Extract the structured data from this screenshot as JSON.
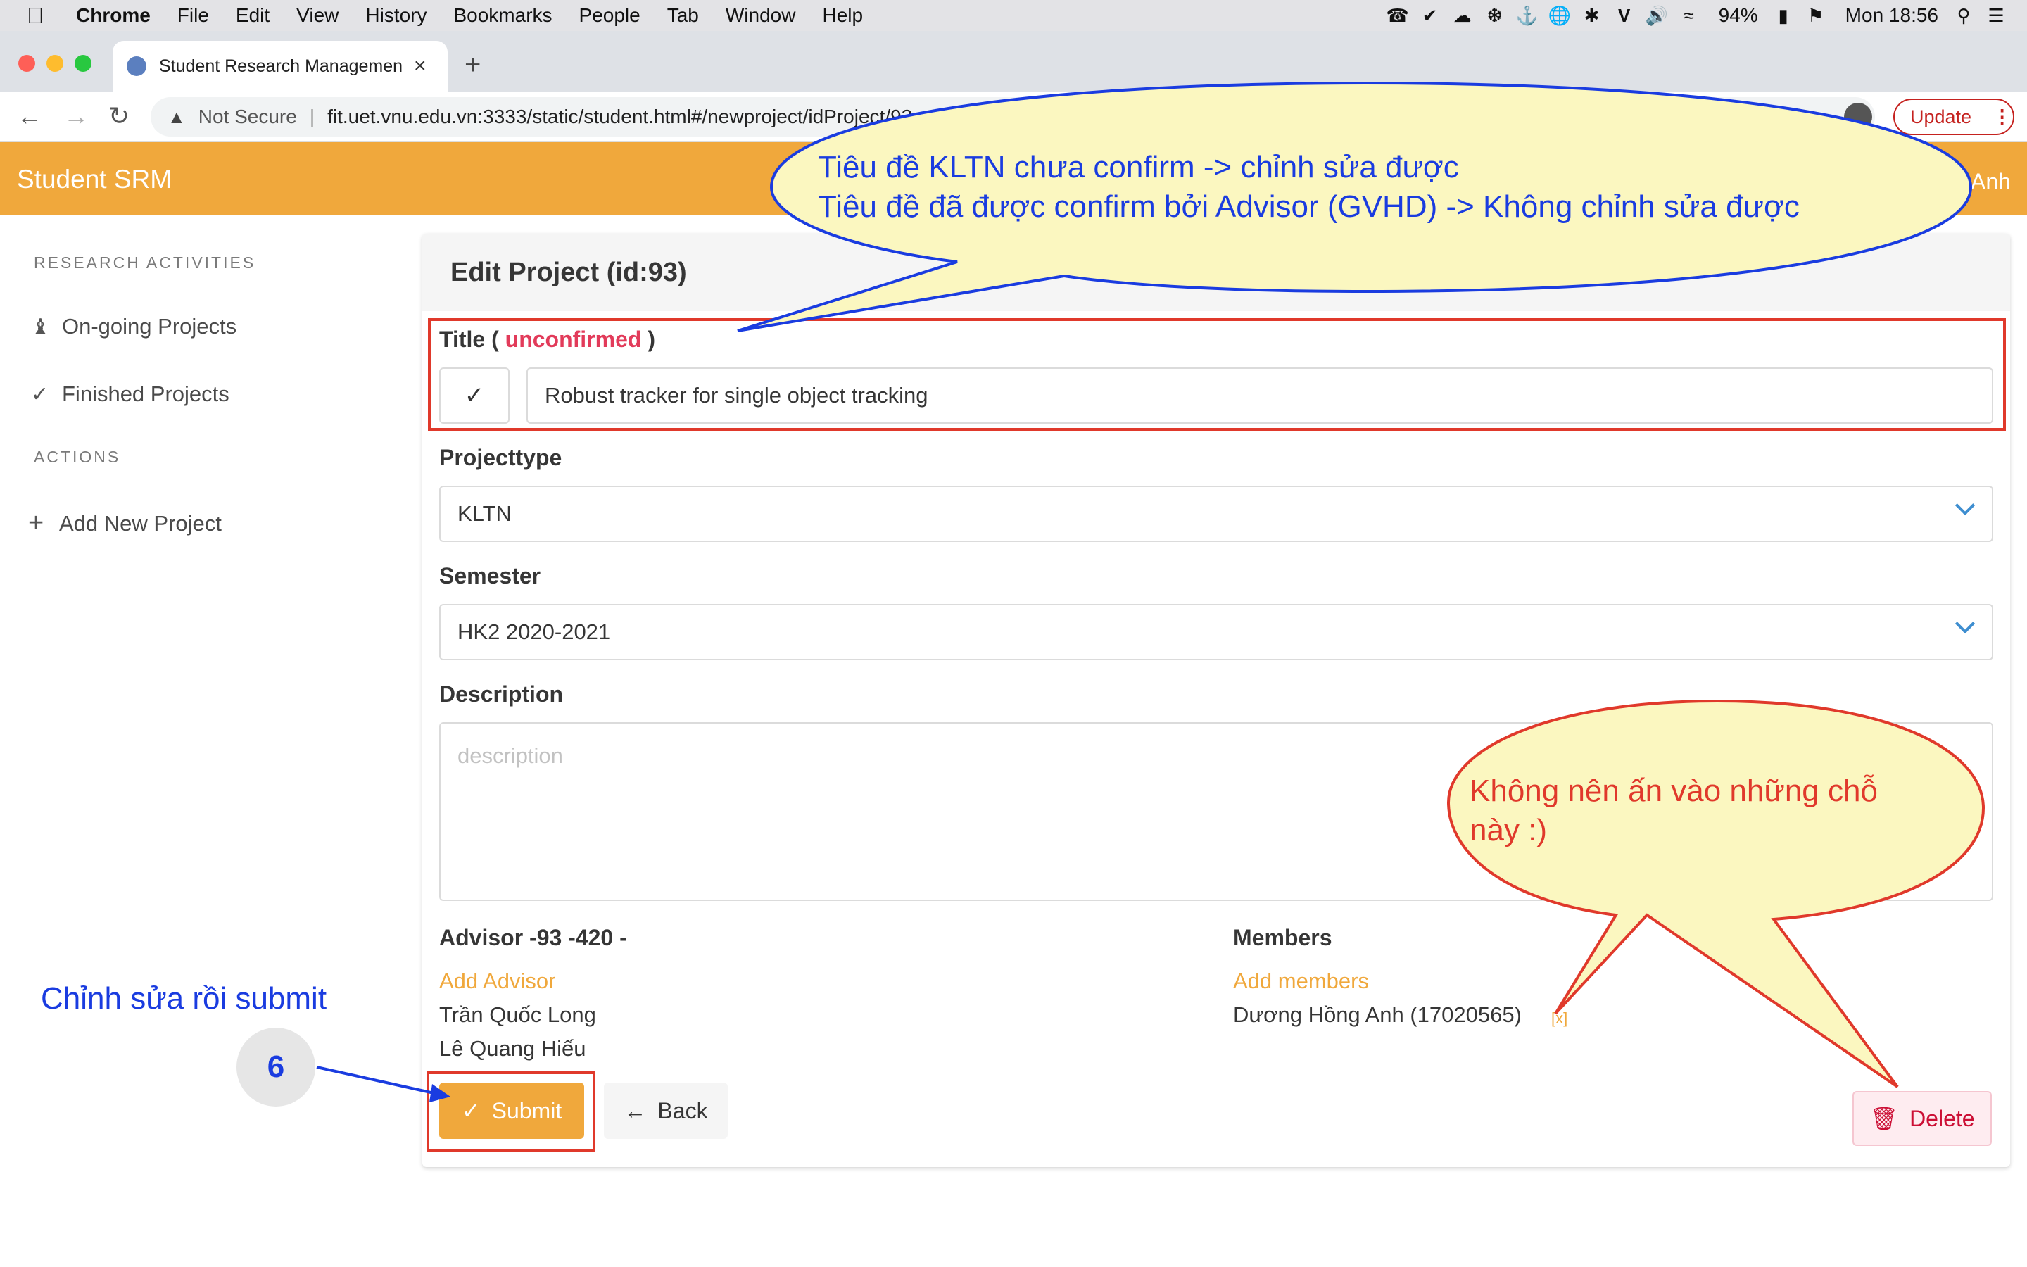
{
  "menubar": {
    "app": "Chrome",
    "items": [
      "File",
      "Edit",
      "View",
      "History",
      "Bookmarks",
      "People",
      "Tab",
      "Window",
      "Help"
    ],
    "battery": "94%",
    "clock": "Mon 18:56"
  },
  "browser": {
    "tab_title": "Student Research Managemen",
    "security_label": "Not Secure",
    "url": "fit.uet.vnu.edu.vn:3333/static/student.html#/newproject/idProject/93",
    "update_label": "Update"
  },
  "app": {
    "brand": "Student SRM",
    "user_name": "Anh"
  },
  "sidebar": {
    "section1": "RESEARCH ACTIVITIES",
    "item_ongoing": "On-going Projects",
    "item_finished": "Finished Projects",
    "section2": "ACTIONS",
    "item_add": "Add New Project"
  },
  "form": {
    "heading": "Edit Project (id:93)",
    "title_label_prefix": "Title (",
    "title_status": "unconfirmed",
    "title_label_suffix": ")",
    "title_value": "Robust tracker for single object tracking",
    "projecttype_label": "Projecttype",
    "projecttype_value": "KLTN",
    "semester_label": "Semester",
    "semester_value": "HK2 2020-2021",
    "description_label": "Description",
    "description_placeholder": "description",
    "advisor_label": "Advisor -93 -420 -",
    "add_advisor": "Add Advisor",
    "advisors": [
      "Trần Quốc Long",
      "Lê Quang Hiếu"
    ],
    "members_label": "Members",
    "add_members": "Add members",
    "member": "Dương Hồng Anh (17020565)",
    "remove_member": "[x]",
    "submit_label": "Submit",
    "back_label": "Back",
    "delete_label": "Delete"
  },
  "annotations": {
    "blue_callout_line1": "Tiêu đề KLTN chưa confirm -> chỉnh sửa được",
    "blue_callout_line2": "Tiêu đề đã được confirm bởi Advisor (GVHD) -> Không chỉnh sửa được",
    "red_callout": "Không nên ấn vào những chỗ này :)",
    "submit_note": "Chỉnh sửa rồi submit",
    "step_number": "6"
  },
  "colors": {
    "accent": "#f0a83c",
    "unconfirmed": "#e23b5a",
    "annotation_blue": "#1a3ce0",
    "annotation_red": "#e0392b",
    "callout_fill": "#fbf7c0"
  }
}
